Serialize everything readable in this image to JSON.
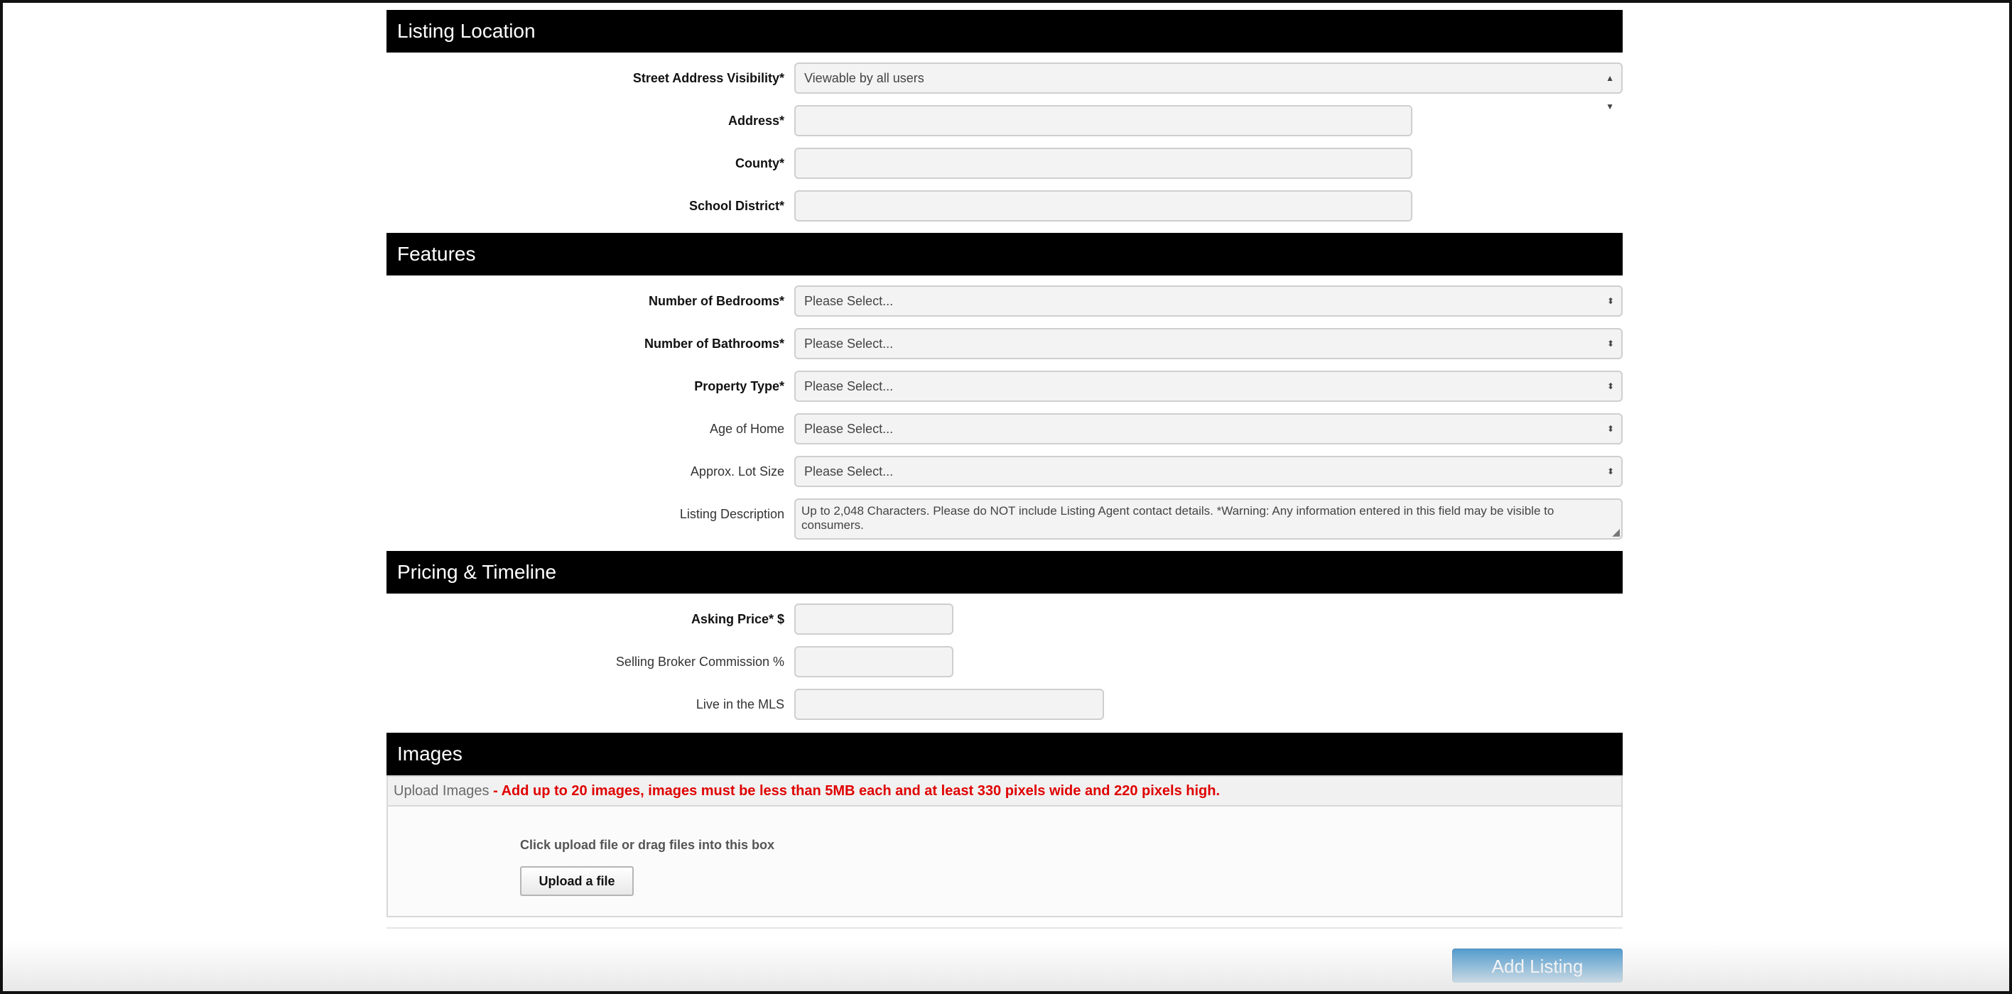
{
  "sections": {
    "location": "Listing Location",
    "features": "Features",
    "pricing": "Pricing & Timeline",
    "images": "Images"
  },
  "location": {
    "visibility_label": "Street Address Visibility*",
    "visibility_value": "Viewable by all users",
    "address_label": "Address*",
    "address_value": "",
    "county_label": "County*",
    "county_value": "",
    "school_label": "School District*",
    "school_value": ""
  },
  "features": {
    "bedrooms_label": "Number of Bedrooms*",
    "bedrooms_value": "Please Select...",
    "bathrooms_label": "Number of Bathrooms*",
    "bathrooms_value": "Please Select...",
    "property_type_label": "Property Type*",
    "property_type_value": "Please Select...",
    "age_label": "Age of Home",
    "age_value": "Please Select...",
    "lot_label": "Approx. Lot Size",
    "lot_value": "Please Select...",
    "description_label": "Listing Description",
    "description_placeholder": "Up to 2,048 Characters. Please do NOT include Listing Agent contact details. *Warning: Any information entered in this field may be visible to consumers."
  },
  "pricing": {
    "asking_label": "Asking Price* $",
    "asking_value": "",
    "commission_label": "Selling Broker Commission %",
    "commission_value": "",
    "mls_label": "Live in the MLS",
    "mls_value": ""
  },
  "images": {
    "upload_prefix": "Upload Images",
    "upload_rules": "- Add up to 20 images, images must be less than 5MB each and at least 330 pixels wide and 220 pixels high.",
    "drop_hint": "Click upload file or drag files into this box",
    "upload_button": "Upload a file"
  },
  "actions": {
    "add_listing": "Add Listing"
  },
  "icons": {
    "select_arrows": "up-down-arrows-icon",
    "annotation": "red-arrow-icon"
  },
  "colors": {
    "header_bg": "#000000",
    "warning_text": "#e00000",
    "primary_button": "#3a8fc9",
    "annotation_arrow": "#e8493f"
  }
}
